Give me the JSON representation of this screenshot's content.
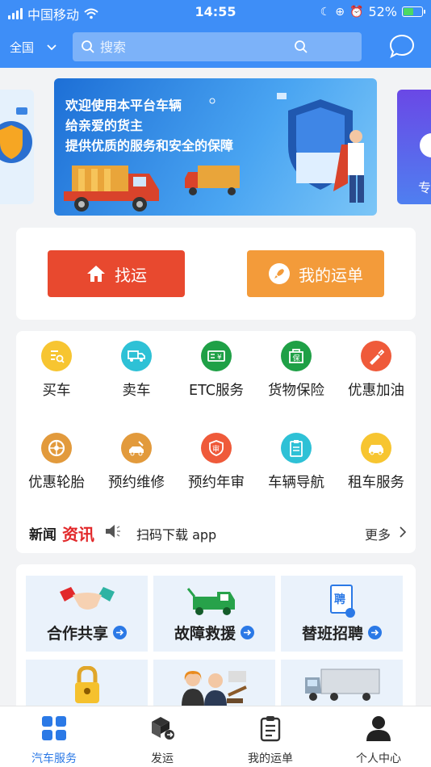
{
  "status_bar": {
    "carrier": "中国移动",
    "time": "14:55",
    "battery": "52%",
    "battery_level": 0.52
  },
  "header": {
    "region": "全国",
    "search_placeholder": "搜索"
  },
  "banner": {
    "line1": "欢迎使用本平台车辆",
    "line2": "给亲爱的货主",
    "line3": "提供优质的服务和安全的保障",
    "right_peek_text": "专"
  },
  "actions": {
    "find_cargo": "找运",
    "my_orders": "我的运单"
  },
  "services": [
    {
      "label": "买车",
      "color": "#f7c531",
      "icon": "search-doc-icon"
    },
    {
      "label": "卖车",
      "color": "#2ec1d6",
      "icon": "truck-icon"
    },
    {
      "label": "ETC服务",
      "color": "#1fa046",
      "icon": "etc-card-icon"
    },
    {
      "label": "货物保险",
      "color": "#1fa046",
      "icon": "insurance-icon"
    },
    {
      "label": "优惠加油",
      "color": "#ef5a3a",
      "icon": "fuel-icon"
    },
    {
      "label": "优惠轮胎",
      "color": "#e29a3c",
      "icon": "tire-icon"
    },
    {
      "label": "预约维修",
      "color": "#e29a3c",
      "icon": "wrench-icon"
    },
    {
      "label": "预约年审",
      "color": "#ef5a3a",
      "icon": "inspection-icon"
    },
    {
      "label": "车辆导航",
      "color": "#2ec1d6",
      "icon": "clipboard-icon"
    },
    {
      "label": "租车服务",
      "color": "#f7c531",
      "icon": "rent-car-icon"
    }
  ],
  "news": {
    "tag_part1": "新闻",
    "tag_part2": "资讯",
    "text": "扫码下载 app",
    "more": "更多"
  },
  "tiles": [
    {
      "label": "合作共享",
      "icon": "handshake-icon"
    },
    {
      "label": "故障救援",
      "icon": "tow-truck-icon"
    },
    {
      "label": "替班招聘",
      "icon": "recruit-icon"
    },
    {
      "label": "",
      "icon": "lock-icon"
    },
    {
      "label": "",
      "icon": "people-icon"
    },
    {
      "label": "",
      "icon": "cargo-truck-icon"
    }
  ],
  "tabbar": [
    {
      "label": "汽车服务",
      "active": true
    },
    {
      "label": "发运",
      "active": false
    },
    {
      "label": "我的运单",
      "active": false
    },
    {
      "label": "个人中心",
      "active": false
    }
  ]
}
